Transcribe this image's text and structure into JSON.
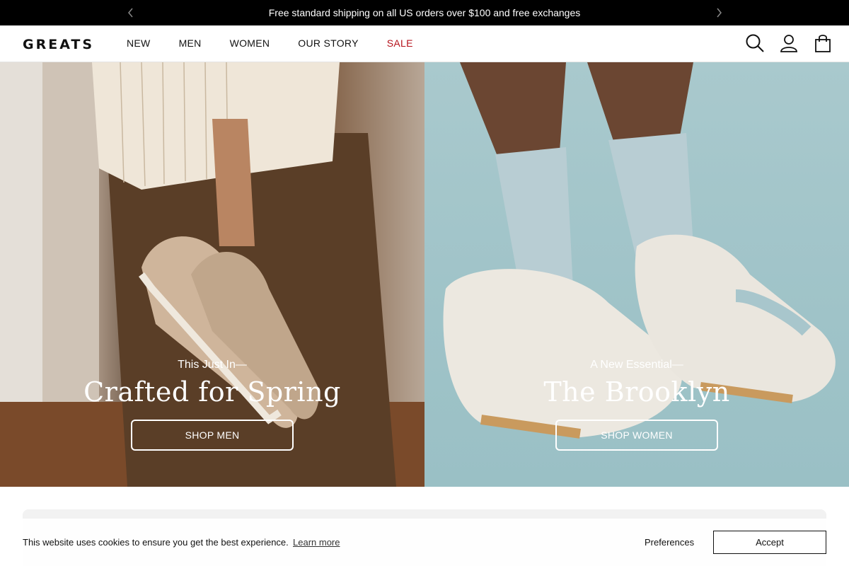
{
  "announcement": {
    "text": "Free standard shipping on all US orders over $100 and free exchanges",
    "prev_icon": "chevron-left-icon",
    "next_icon": "chevron-right-icon"
  },
  "header": {
    "logo": "GREATS",
    "nav": [
      "NEW",
      "MEN",
      "WOMEN",
      "OUR STORY",
      "SALE"
    ],
    "sale_color": "#b5121b",
    "icons": [
      "search-icon",
      "account-icon",
      "bag-icon"
    ]
  },
  "hero": {
    "men": {
      "eyebrow": "This Just In—",
      "headline": "Crafted for Spring",
      "button": "SHOP MEN"
    },
    "women": {
      "eyebrow": "A New Essential—",
      "headline": "The Brooklyn",
      "button": "SHOP WOMEN"
    }
  },
  "cookie": {
    "message": "This website uses cookies to ensure you get the best experience.",
    "learn_more": "Learn more",
    "preferences": "Preferences",
    "accept": "Accept"
  }
}
